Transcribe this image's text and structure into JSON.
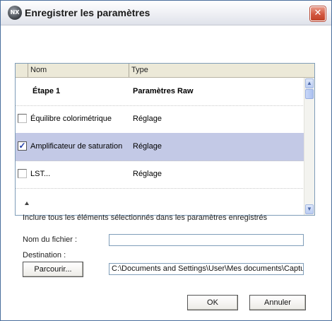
{
  "window": {
    "title": "Enregistrer les paramètres",
    "app_icon_text": "NX",
    "close_glyph": "✕"
  },
  "list": {
    "columns": [
      "Nom",
      "Type"
    ],
    "group": {
      "name": "Étape 1",
      "type": "Paramètres Raw"
    },
    "items": [
      {
        "name": "Équilibre colorimétrique",
        "type": "Réglage",
        "checked": false
      },
      {
        "name": "Amplificateur de saturation",
        "type": "Réglage",
        "checked": true
      },
      {
        "name": "LST...",
        "type": "Réglage",
        "checked": false
      }
    ],
    "check_glyph": "✓",
    "scroll_up": "▲",
    "scroll_down": "▼"
  },
  "form": {
    "include_text": "Inclure tous les éléments sélectionnés dans les paramètres enregistrés",
    "filename_label": "Nom du fichier :",
    "filename_value": "",
    "destination_label": "Destination :",
    "browse_label": "Parcourir...",
    "destination_value": "C:\\Documents and Settings\\User\\Mes documents\\Captu"
  },
  "buttons": {
    "ok": "OK",
    "cancel": "Annuler"
  },
  "colors": {
    "selected_row": "#c3c9e6",
    "close_button": "#d2563e",
    "border": "#7f9db9"
  }
}
